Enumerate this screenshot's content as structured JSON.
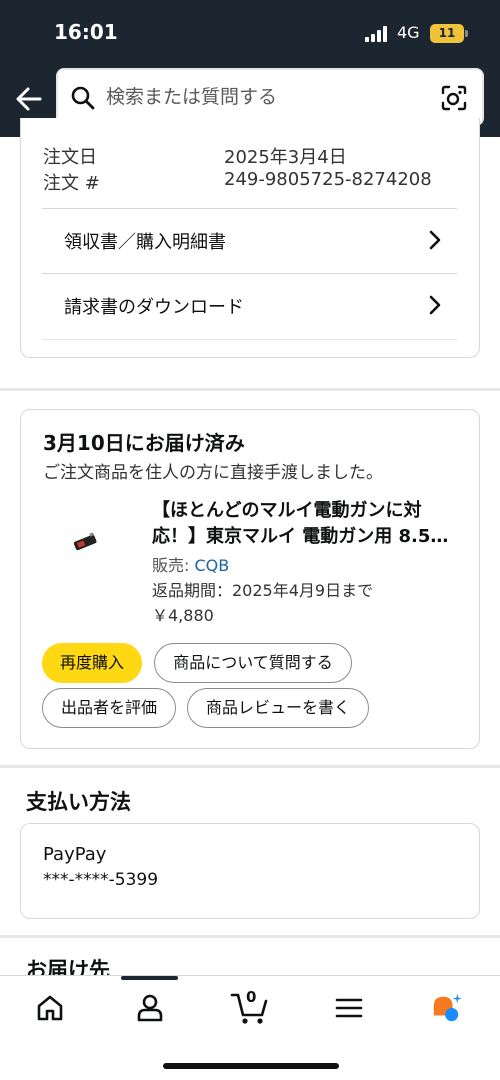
{
  "status_bar": {
    "time": "16:01",
    "network": "4G",
    "battery": "11"
  },
  "header": {
    "search_placeholder": "検索または質問する"
  },
  "order_info": {
    "date_label": "注文日",
    "date_value": "2025年3月4日",
    "number_label": "注文 #",
    "number_value": "249-9805725-8274208",
    "links": [
      {
        "label": "領収書／購入明細書"
      },
      {
        "label": "請求書のダウンロード"
      }
    ]
  },
  "delivery": {
    "title": "3月10日にお届け済み",
    "subtitle": "ご注文商品を住人の方に直接手渡しました。",
    "product": {
      "title_line1": "【ほとんどのマルイ電動ガンに対",
      "title_line2": "応！】東京マルイ 電動ガン用 8.5V ...",
      "seller_label": "販売: ",
      "seller_name": "CQB",
      "return_period": "返品期間：2025年4月9日まで",
      "price": "￥4,880"
    },
    "buttons": {
      "buy_again": "再度購入",
      "ask_question": "商品について質問する",
      "rate_seller": "出品者を評価",
      "write_review": "商品レビューを書く"
    }
  },
  "payment": {
    "heading": "支払い方法",
    "method": "PayPay",
    "masked_number": "***-****-5399"
  },
  "shipping": {
    "heading": "お届け先"
  },
  "bottom_nav": {
    "items": [
      {
        "icon": "home-icon"
      },
      {
        "icon": "account-icon"
      },
      {
        "icon": "cart-icon",
        "count": "0"
      },
      {
        "icon": "menu-icon"
      },
      {
        "icon": "assistant-icon"
      }
    ]
  },
  "colors": {
    "header_bg": "#1c2631",
    "buy_again_bg": "#ffd814",
    "link_blue": "#2162a1",
    "assistant_orange": "#f57921",
    "assistant_blue": "#1a8cff"
  }
}
